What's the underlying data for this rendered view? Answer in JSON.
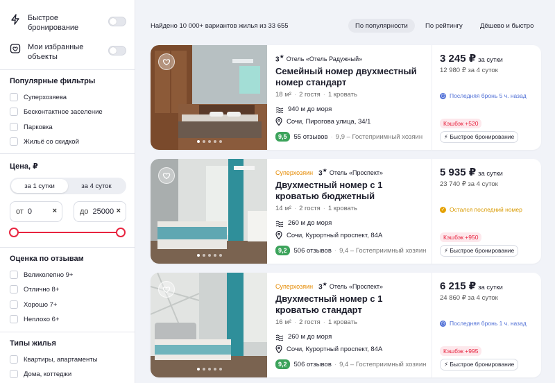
{
  "sidebar": {
    "toggles": [
      {
        "label": "Быстрое бронирование",
        "icon": "lightning-icon"
      },
      {
        "label": "Мои избранные объекты",
        "icon": "heart-list-icon"
      }
    ],
    "popular_title": "Популярные фильтры",
    "popular": [
      "Суперхозяева",
      "Бесконтактное заселение",
      "Парковка",
      "Жильё со скидкой"
    ],
    "price_title": "Цена, ₽",
    "price_tabs": [
      "за 1 сутки",
      "за 4 суток"
    ],
    "price_from_label": "от",
    "price_from_value": "0",
    "price_to_label": "до",
    "price_to_value": "25000",
    "clear_symbol": "×",
    "rating_title": "Оценка по отзывам",
    "ratings": [
      "Великолепно 9+",
      "Отлично 8+",
      "Хорошо 7+",
      "Неплохо 6+"
    ],
    "types_title": "Типы жилья",
    "types": [
      "Квартиры, апартаменты",
      "Дома, коттеджи"
    ]
  },
  "results": {
    "found_text": "Найдено 10 000+ вариантов жилья из 33 655",
    "sort_tabs": [
      "По популярности",
      "По рейтингу",
      "Дёшево и быстро"
    ]
  },
  "colors": {
    "accent": "#e8243f",
    "superhost": "#e58a00",
    "score": "#3ca35b",
    "blue": "#4f6fd6"
  },
  "cards": [
    {
      "superhost": "",
      "stars": "3",
      "hotel": "Отель «Отель Радужный»",
      "title": "Семейный номер двухместный номер стандарт",
      "area": "18 м²",
      "guests": "2 гостя",
      "beds": "1 кровать",
      "sea": "940 м до моря",
      "address": "Сочи, Пирогова улица, 34/1",
      "score": "9,5",
      "reviews": "55 отзывов",
      "comment": "9,9 – Гостеприимный хозяин",
      "price": "3 245 ₽",
      "per": "за сутки",
      "total": "12 980 ₽ за 4 суток",
      "note": "Последняя бронь 5 ч. назад",
      "note_color": "#4f6fd6",
      "cashback": "Кэшбэк +520",
      "quick": "Быстрое бронирование"
    },
    {
      "superhost": "Суперхозяин",
      "stars": "3",
      "hotel": "Отель «Проспект»",
      "title": "Двухместный номер с 1 кроватью бюджетный",
      "area": "14 м²",
      "guests": "2 гостя",
      "beds": "1 кровать",
      "sea": "260 м до моря",
      "address": "Сочи, Курортный проспект, 84А",
      "score": "9,2",
      "reviews": "506 отзывов",
      "comment": "9,4 – Гостеприимный хозяин",
      "price": "5 935 ₽",
      "per": "за сутки",
      "total": "23 740 ₽ за 4 суток",
      "note": "Остался последний номер",
      "note_color": "#e5a100",
      "cashback": "Кэшбэк +950",
      "quick": "Быстрое бронирование"
    },
    {
      "superhost": "Суперхозяин",
      "stars": "3",
      "hotel": "Отель «Проспект»",
      "title": "Двухместный номер с 1 кроватью стандарт",
      "area": "16 м²",
      "guests": "2 гостя",
      "beds": "1 кровать",
      "sea": "260 м до моря",
      "address": "Сочи, Курортный проспект, 84А",
      "score": "9,2",
      "reviews": "506 отзывов",
      "comment": "9,4 – Гостеприимный хозяин",
      "price": "6 215 ₽",
      "per": "за сутки",
      "total": "24 860 ₽ за 4 суток",
      "note": "Последняя бронь 1 ч. назад",
      "note_color": "#4f6fd6",
      "cashback": "Кэшбэк +995",
      "quick": "Быстрое бронирование"
    }
  ]
}
